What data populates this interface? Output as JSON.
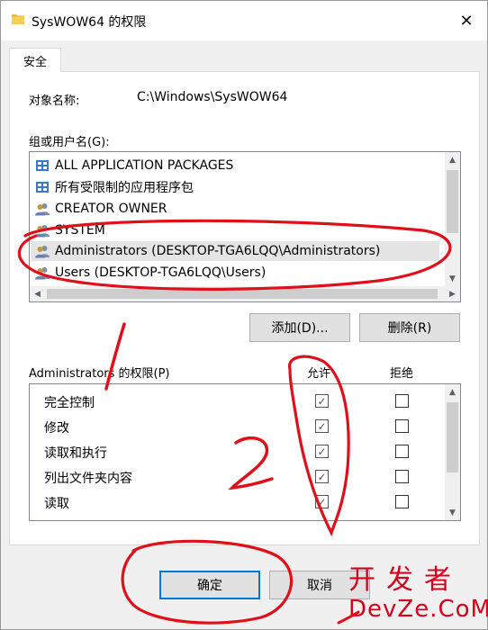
{
  "window": {
    "title": "SysWOW64 的权限",
    "close_glyph": "✕",
    "icon": "folder-icon"
  },
  "tabs": [
    {
      "label": "安全",
      "active": true
    }
  ],
  "object": {
    "label": "对象名称:",
    "value": "C:\\Windows\\SysWOW64"
  },
  "groups": {
    "label": "组或用户名(G):",
    "items": [
      {
        "label": "ALL APPLICATION PACKAGES",
        "icon": "app-package-icon"
      },
      {
        "label": "所有受限制的应用程序包",
        "icon": "app-package-icon"
      },
      {
        "label": "CREATOR OWNER",
        "icon": "users-icon"
      },
      {
        "label": "SYSTEM",
        "icon": "users-icon"
      },
      {
        "label": "Administrators (DESKTOP-TGA6LQQ\\Administrators)",
        "icon": "users-icon",
        "selected": true
      },
      {
        "label": "Users (DESKTOP-TGA6LQQ\\Users)",
        "icon": "users-icon"
      }
    ]
  },
  "buttons": {
    "add": "添加(D)...",
    "remove": "删除(R)",
    "ok": "确定",
    "cancel": "取消"
  },
  "permissions": {
    "label": "Administrators 的权限(P)",
    "allow_header": "允许",
    "deny_header": "拒绝",
    "rows": [
      {
        "name": "完全控制",
        "allow": true,
        "deny": false
      },
      {
        "name": "修改",
        "allow": true,
        "deny": false
      },
      {
        "name": "读取和执行",
        "allow": true,
        "deny": false
      },
      {
        "name": "列出文件夹内容",
        "allow": true,
        "deny": false
      },
      {
        "name": "读取",
        "allow": true,
        "deny": false
      }
    ]
  },
  "annotations": {
    "handwritten_1": "1",
    "handwritten_2": "2",
    "color": "#e0101a"
  },
  "watermark": {
    "line1": "开发者",
    "line2": "DevZe.CoM",
    "color": "#d7001b"
  }
}
